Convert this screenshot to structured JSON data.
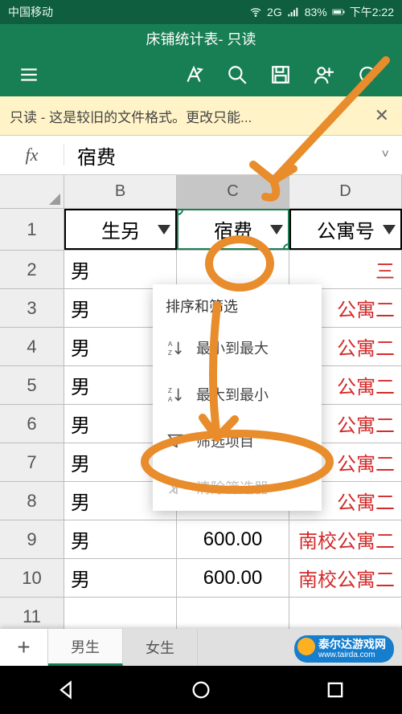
{
  "status": {
    "carrier": "中国移动",
    "network": "2G",
    "battery": "83%",
    "time": "下午2:22"
  },
  "app": {
    "title_main": "床铺统计表",
    "title_suffix": " - 只读"
  },
  "warning": {
    "text": "只读 - 这是较旧的文件格式。更改只能..."
  },
  "formula": {
    "fx": "fx",
    "value": "宿费"
  },
  "columns": [
    "B",
    "C",
    "D"
  ],
  "selected_column_index": 1,
  "header_row": {
    "cells": [
      {
        "text": "生另",
        "has_filter": true
      },
      {
        "text": "宿费",
        "has_filter": true,
        "selected": true
      },
      {
        "text": "公寓号",
        "has_filter": true
      }
    ]
  },
  "rows": [
    {
      "n": "1",
      "is_header": true
    },
    {
      "n": "2",
      "b": "男",
      "c": "",
      "d_red": "三"
    },
    {
      "n": "3",
      "b": "男",
      "c": "",
      "d_red": "公寓二"
    },
    {
      "n": "4",
      "b": "男",
      "c": "",
      "d_red": "公寓二"
    },
    {
      "n": "5",
      "b": "男",
      "c": "",
      "d_red": "公寓二"
    },
    {
      "n": "6",
      "b": "男",
      "c": "",
      "d_red": "公寓二"
    },
    {
      "n": "7",
      "b": "男",
      "c": "",
      "d_red": "公寓二"
    },
    {
      "n": "8",
      "b": "男",
      "c": "",
      "d_red": "公寓二"
    },
    {
      "n": "9",
      "b": "男",
      "c": "600.00",
      "d_red": "南校公寓二"
    },
    {
      "n": "10",
      "b": "男",
      "c": "600.00",
      "d_red": "南校公寓二"
    },
    {
      "n": "11",
      "b": "",
      "c": "",
      "d_red": ""
    }
  ],
  "dropdown": {
    "title": "排序和筛选",
    "items": [
      {
        "label": "最小到最大",
        "icon": "sort-asc",
        "disabled": false
      },
      {
        "label": "最大到最小",
        "icon": "sort-desc",
        "disabled": false
      },
      {
        "label": "筛选项目",
        "icon": "funnel",
        "has_chevron": true
      },
      {
        "label": "清除筛选器",
        "icon": "funnel-x",
        "disabled": true
      }
    ]
  },
  "sheets": {
    "tabs": [
      "男生",
      "女生"
    ],
    "active_index": 0
  },
  "watermark": {
    "label_top": "泰尔达游戏网",
    "label_bottom": "www.tairda.com"
  }
}
